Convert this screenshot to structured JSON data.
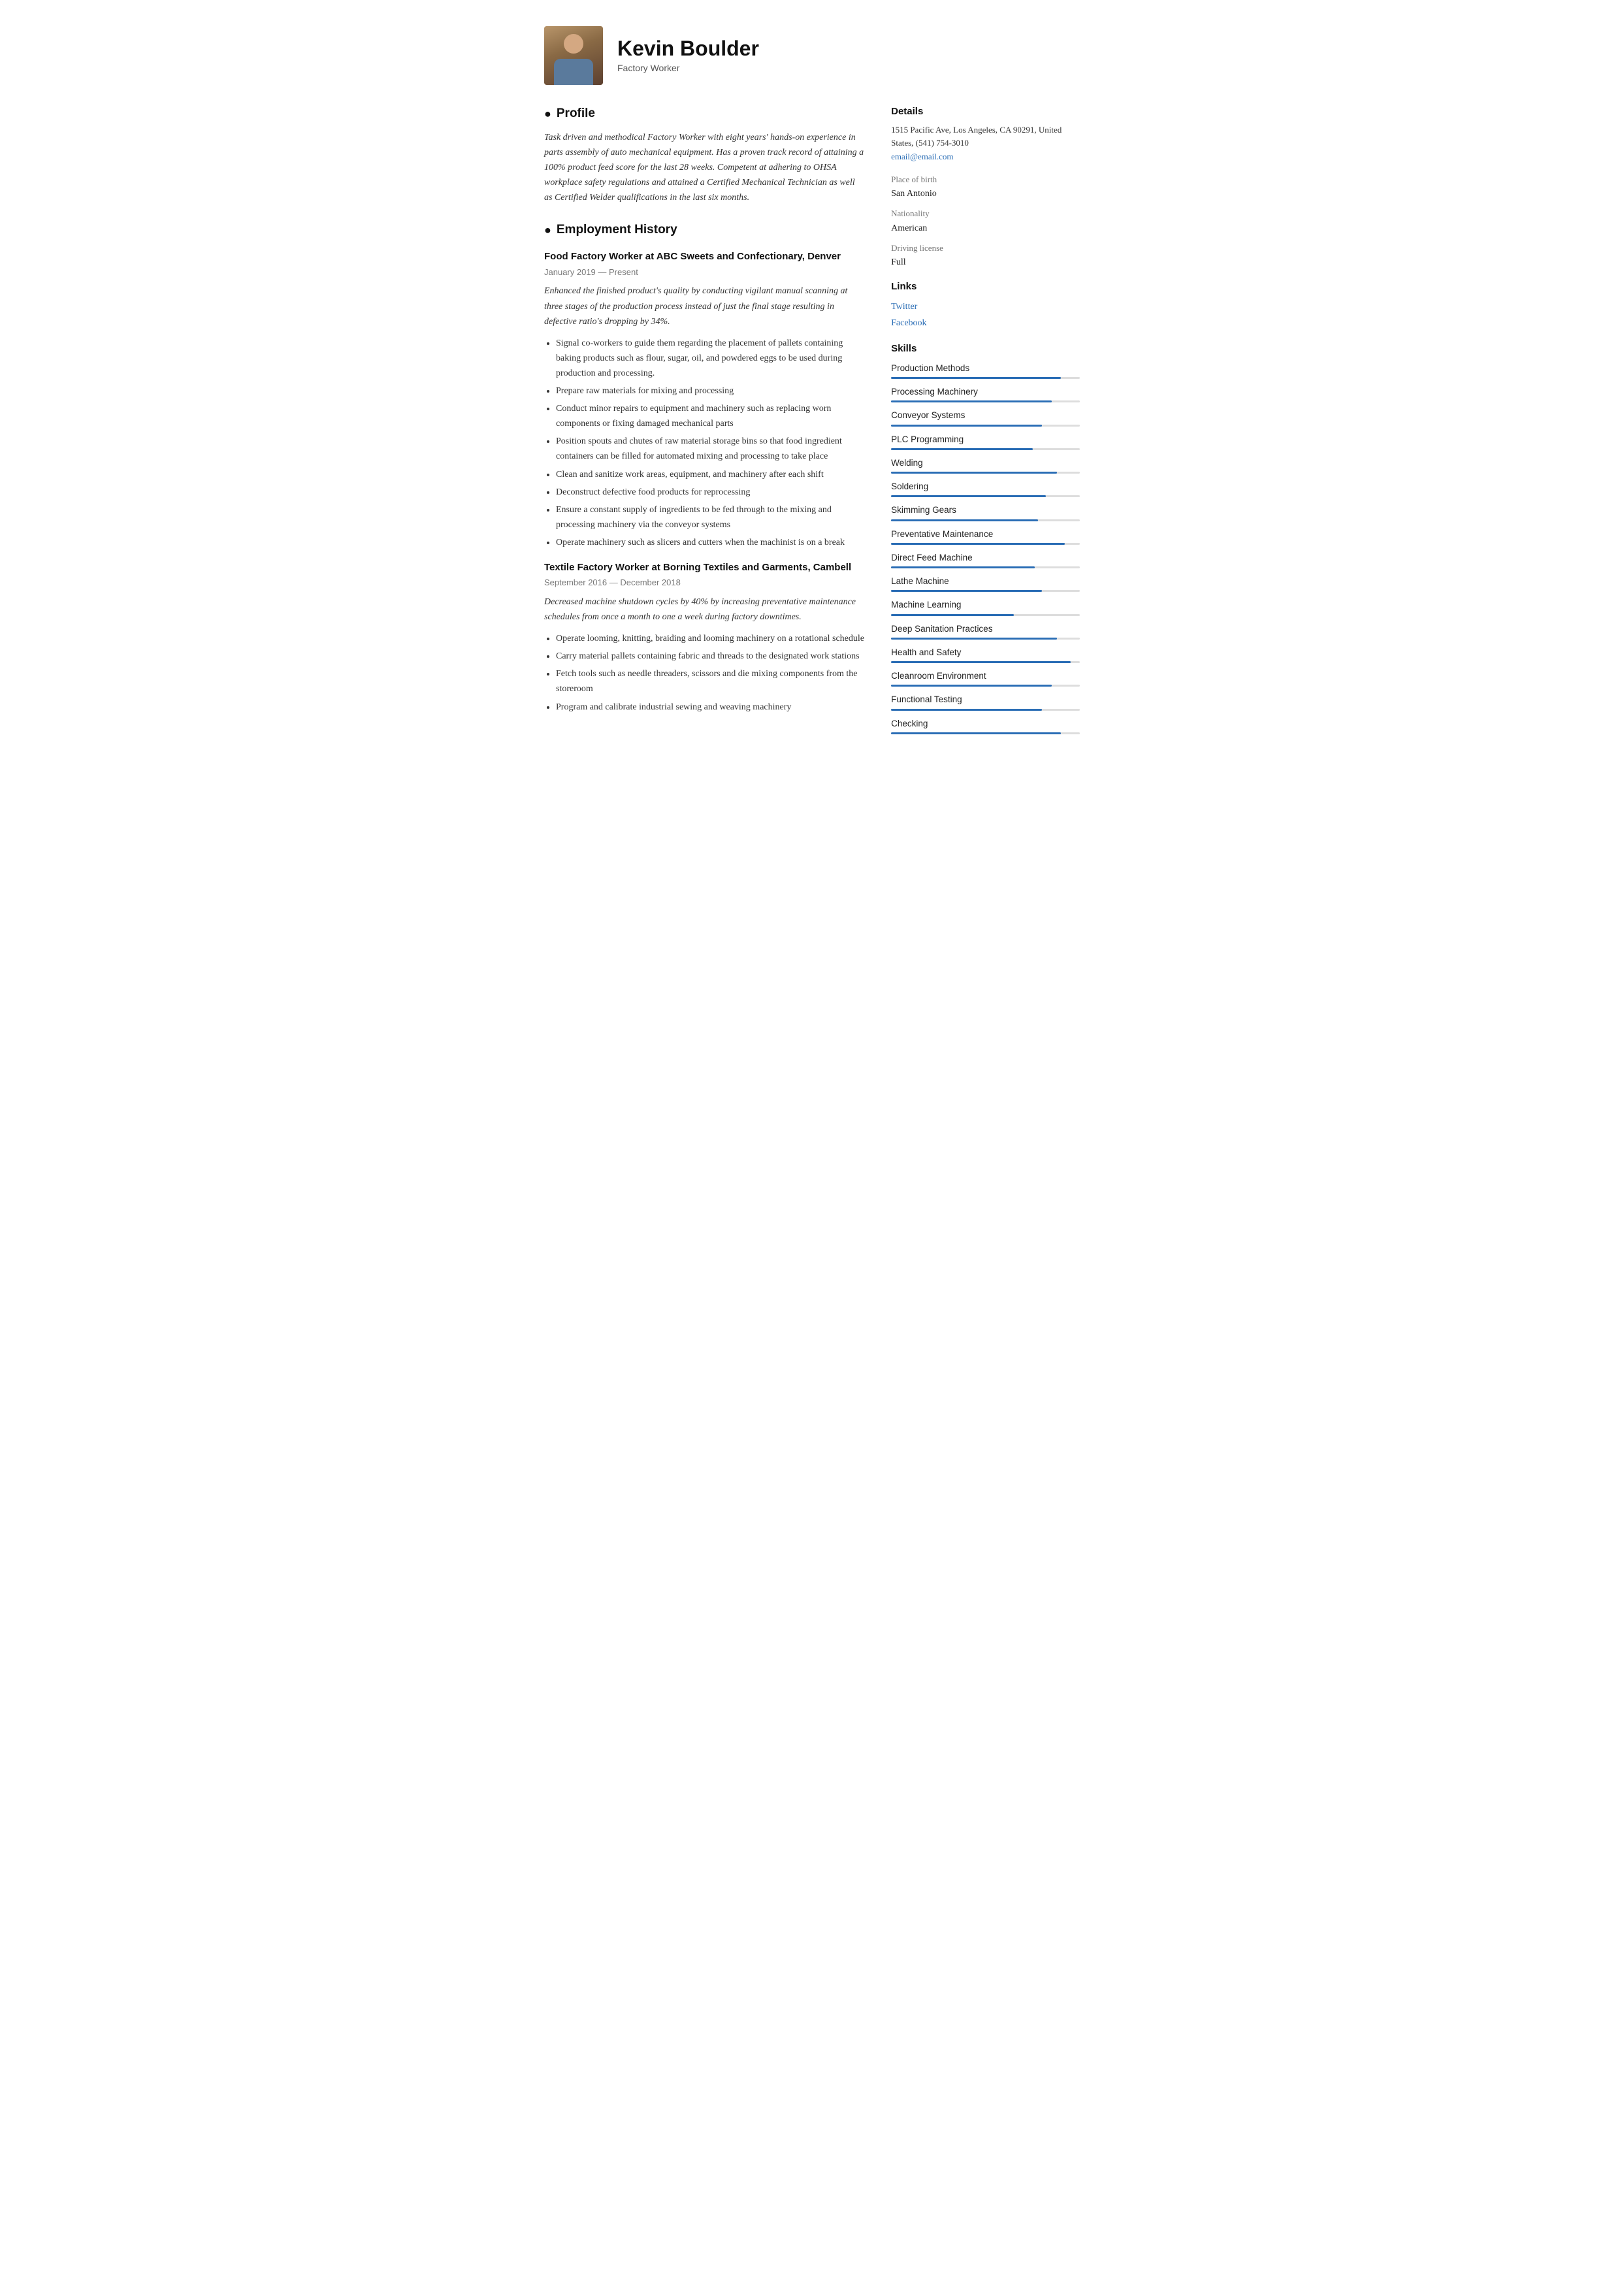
{
  "header": {
    "name": "Kevin Boulder",
    "title": "Factory Worker"
  },
  "profile": {
    "section_label": "Profile",
    "icon": "👤",
    "text": "Task driven and methodical Factory Worker with eight years' hands-on experience in parts assembly of auto mechanical equipment. Has a proven track record of attaining a 100% product feed score for the last 28 weeks. Competent at adhering to OHSA workplace safety regulations and attained a Certified Mechanical Technician as well as Certified Welder qualifications in the last six months."
  },
  "employment": {
    "section_label": "Employment History",
    "icon": "💼",
    "jobs": [
      {
        "title": "Food Factory Worker at  ABC Sweets and Confectionary, Denver",
        "dates": "January 2019 — Present",
        "summary": "Enhanced the finished product's quality by conducting vigilant manual scanning at three stages of the production process instead of just the final stage resulting in defective ratio's dropping by 34%.",
        "bullets": [
          "Signal co-workers to guide them regarding the placement of pallets containing baking products such as flour, sugar, oil, and powdered eggs to be used during production and processing.",
          "Prepare raw materials for mixing and processing",
          "Conduct minor repairs to equipment and machinery such as replacing worn components or fixing damaged mechanical parts",
          "Position spouts and chutes of raw material storage bins so that food ingredient containers can be filled for automated mixing and processing to take place",
          "Clean and sanitize work areas, equipment, and machinery after each shift",
          "Deconstruct defective food products for reprocessing",
          "Ensure a constant supply of ingredients to be fed through to the mixing and processing machinery via the conveyor systems",
          "Operate machinery such as slicers and cutters when the machinist is on a break"
        ]
      },
      {
        "title": "Textile Factory Worker at  Borning Textiles and Garments, Cambell",
        "dates": "September 2016 — December 2018",
        "summary": "Decreased machine shutdown cycles by 40% by increasing preventative maintenance schedules from once a month to one a week during factory downtimes.",
        "bullets": [
          "Operate looming, knitting, braiding and looming machinery on a rotational schedule",
          "Carry material pallets containing fabric and threads to the designated work stations",
          "Fetch tools such as needle threaders, scissors and die mixing components from the storeroom",
          "Program and calibrate industrial sewing and weaving machinery"
        ]
      }
    ]
  },
  "sidebar": {
    "details_heading": "Details",
    "address": "1515 Pacific Ave, Los Angeles, CA 90291, United States, (541) 754-3010",
    "email": "email@email.com",
    "place_of_birth_label": "Place of birth",
    "place_of_birth": "San Antonio",
    "nationality_label": "Nationality",
    "nationality": "American",
    "driving_label": "Driving license",
    "driving": "Full",
    "links_heading": "Links",
    "links": [
      {
        "label": "Twitter",
        "href": "#"
      },
      {
        "label": "Facebook",
        "href": "#"
      }
    ],
    "skills_heading": "Skills",
    "skills": [
      {
        "name": "Production Methods",
        "pct": 90
      },
      {
        "name": "Processing Machinery",
        "pct": 85
      },
      {
        "name": "Conveyor Systems",
        "pct": 80
      },
      {
        "name": "PLC Programming",
        "pct": 75
      },
      {
        "name": "Welding",
        "pct": 88
      },
      {
        "name": "Soldering",
        "pct": 82
      },
      {
        "name": "Skimming Gears",
        "pct": 78
      },
      {
        "name": "Preventative Maintenance",
        "pct": 92
      },
      {
        "name": "Direct Feed Machine",
        "pct": 76
      },
      {
        "name": "Lathe Machine",
        "pct": 80
      },
      {
        "name": "Machine Learning",
        "pct": 65
      },
      {
        "name": "Deep Sanitation Practices",
        "pct": 88
      },
      {
        "name": "Health and Safety",
        "pct": 95
      },
      {
        "name": "Cleanroom Environment",
        "pct": 85
      },
      {
        "name": "Functional Testing",
        "pct": 80
      },
      {
        "name": "Checking",
        "pct": 90
      }
    ]
  }
}
